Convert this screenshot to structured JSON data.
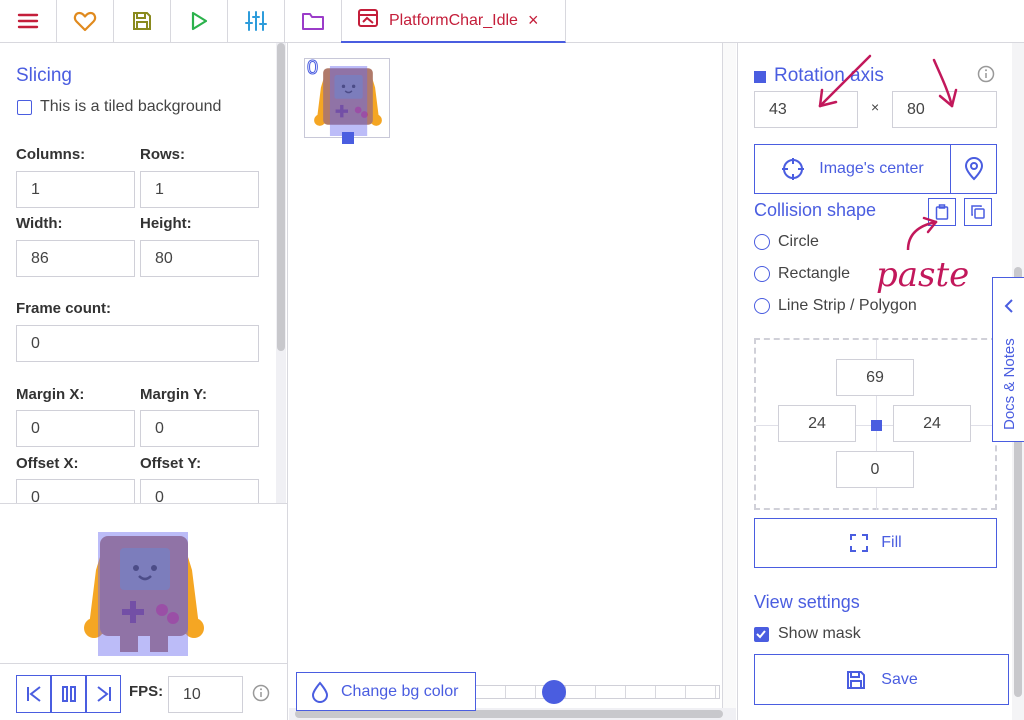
{
  "toolbar": {
    "icons": [
      "menu-icon",
      "heart-icon",
      "save-icon",
      "play-icon",
      "sliders-icon",
      "folder-icon"
    ],
    "tab": {
      "label": "PlatformChar_Idle",
      "close": "×"
    }
  },
  "slicing": {
    "title": "Slicing",
    "tiled_label": "This is a tiled background",
    "columns_label": "Columns:",
    "columns": "1",
    "rows_label": "Rows:",
    "rows": "1",
    "width_label": "Width:",
    "width": "86",
    "height_label": "Height:",
    "height": "80",
    "frame_count_label": "Frame count:",
    "frame_count": "0",
    "margin_x_label": "Margin X:",
    "margin_x": "0",
    "margin_y_label": "Margin Y:",
    "margin_y": "0",
    "offset_x_label": "Offset X:",
    "offset_x": "0",
    "offset_y_label": "Offset Y:",
    "offset_y": "0"
  },
  "player": {
    "fps_label": "FPS:",
    "fps": "10"
  },
  "canvas": {
    "frame_index": "0",
    "bg_button": "Change bg color",
    "zoom_level": 0.3
  },
  "rotation": {
    "title": "Rotation axis",
    "x": "43",
    "times": "×",
    "y": "80",
    "center_button": "Image's center"
  },
  "collision": {
    "title": "Collision shape",
    "options": [
      "Circle",
      "Rectangle",
      "Line Strip / Polygon"
    ],
    "top": "69",
    "left": "24",
    "right": "24",
    "bottom": "0",
    "fill_button": "Fill"
  },
  "view": {
    "title": "View settings",
    "show_mask": "Show mask",
    "save_button": "Save"
  },
  "docs": {
    "label": "Docs & Notes"
  },
  "annotation": {
    "text": "paste"
  },
  "colors": {
    "accent": "#4a5de0",
    "tab_text": "#c41e3a",
    "annotation": "#c2185b"
  }
}
